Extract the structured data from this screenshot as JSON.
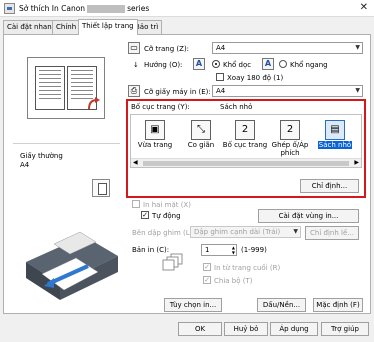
{
  "window": {
    "title_prefix": "Sở thích In Canon",
    "title_suffix": "series",
    "close_symbol": "✕"
  },
  "tabs": [
    {
      "label": "Cài đặt nhanh"
    },
    {
      "label": "Chính"
    },
    {
      "label": "Thiết lập trang"
    },
    {
      "label": "Bảo trì"
    }
  ],
  "preview": {
    "media_label": "Giấy thường",
    "media_value": "A4"
  },
  "page_setup": {
    "page_size_label": "Cỡ trang (Z):",
    "page_size_value": "A4",
    "orientation_label": "Hướng (O):",
    "portrait_label": "Khổ dọc",
    "landscape_label": "Khổ ngang",
    "rotate_label": "Xoay 180 độ (1)",
    "printer_paper_label": "Cỡ giấy máy in (E):",
    "printer_paper_value": "A4",
    "layout_label": "Bố cục trang (Y):",
    "layout_value": "Sách nhỏ",
    "layouts": [
      {
        "label": "Vừa trang",
        "icon": "fit-page-icon",
        "glyph": "▣"
      },
      {
        "label": "Co giãn",
        "icon": "scaled-icon",
        "glyph": "⤡"
      },
      {
        "label": "Bố cục trang",
        "icon": "page-layout-icon",
        "glyph": "2"
      },
      {
        "label": "Ghép ố/Áp phích",
        "icon": "tiling-poster-icon",
        "glyph": "2"
      },
      {
        "label": "Sách nhỏ",
        "icon": "booklet-icon",
        "glyph": "▤"
      }
    ],
    "specify_button": "Chỉ định...",
    "duplex_label": "In hai mặt (X)",
    "auto_label": "Tự động",
    "print_area_button": "Cài đặt vùng in...",
    "stapling_label": "Bên dập ghim (L):",
    "stapling_value": "Dập ghim cạnh dài (Trái)",
    "margin_button": "Chỉ định lề...",
    "copies_label": "Bản in (C):",
    "copies_value": "1",
    "copies_range": "(1-999)",
    "last_page_first_label": "In từ trang cuối (R)",
    "collate_label": "Chia bộ (T)",
    "options_button": "Tùy chọn in...",
    "stamp_button": "Dấu/Nền...",
    "defaults_button": "Mặc định (F)"
  },
  "footer": {
    "ok": "OK",
    "cancel": "Huỷ bỏ",
    "apply": "Áp dụng",
    "help": "Trợ giúp"
  }
}
